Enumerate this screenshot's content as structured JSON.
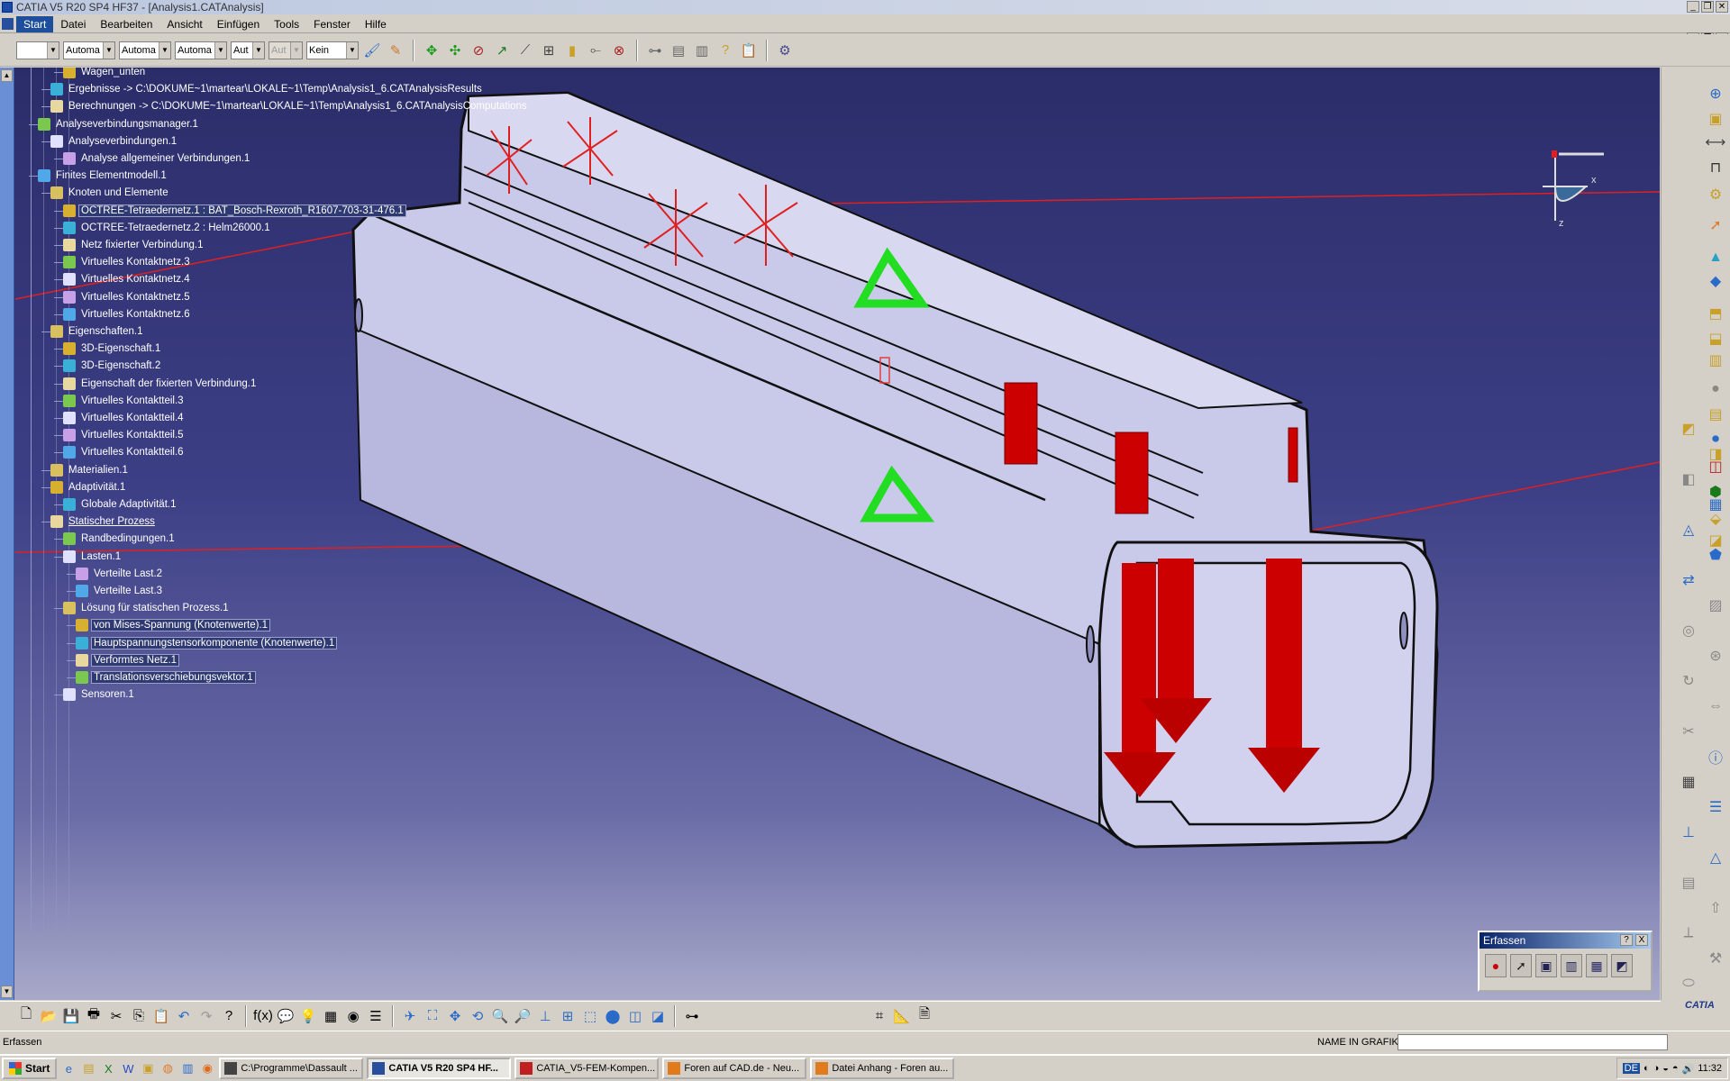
{
  "window": {
    "title": "CATIA V5 R20 SP4 HF37 - [Analysis1.CATAnalysis]"
  },
  "menu": [
    "Start",
    "Datei",
    "Bearbeiten",
    "Ansicht",
    "Einfügen",
    "Tools",
    "Fenster",
    "Hilfe"
  ],
  "toolbar": {
    "combo1": "",
    "combo2": "Automa",
    "combo3": "Automa",
    "combo4": "Automa",
    "combo5": "Aut",
    "combo6": "Aut",
    "combo7": "Kein"
  },
  "tree": [
    {
      "label": "Wagen_unten",
      "level": 3,
      "icon": "part-icon"
    },
    {
      "label": "Ergebnisse -> C:\\DOKUME~1\\martear\\LOKALE~1\\Temp\\Analysis1_6.CATAnalysisResults",
      "level": 2,
      "icon": "results-icon"
    },
    {
      "label": "Berechnungen -> C:\\DOKUME~1\\martear\\LOKALE~1\\Temp\\Analysis1_6.CATAnalysisComputations",
      "level": 2,
      "icon": "computations-icon"
    },
    {
      "label": "Analyseverbindungsmanager.1",
      "level": 1,
      "icon": "manager-icon"
    },
    {
      "label": "Analyseverbindungen.1",
      "level": 2,
      "icon": "connections-icon"
    },
    {
      "label": "Analyse allgemeiner Verbindungen.1",
      "level": 3,
      "icon": "connection-icon"
    },
    {
      "label": "Finites Elementmodell.1",
      "level": 1,
      "icon": "fem-icon"
    },
    {
      "label": "Knoten und Elemente",
      "level": 2,
      "icon": "nodes-icon"
    },
    {
      "label": "OCTREE-Tetraedernetz.1 : BAT_Bosch-Rexroth_R1607-703-31-476.1",
      "level": 3,
      "icon": "mesh-icon",
      "selected": true
    },
    {
      "label": "OCTREE-Tetraedernetz.2 : Helm26000.1",
      "level": 3,
      "icon": "mesh-icon"
    },
    {
      "label": "Netz fixierter Verbindung.1",
      "level": 3,
      "icon": "fixed-mesh-icon"
    },
    {
      "label": "Virtuelles Kontaktnetz.3",
      "level": 3,
      "icon": "contact-mesh-icon"
    },
    {
      "label": "Virtuelles Kontaktnetz.4",
      "level": 3,
      "icon": "contact-mesh-icon"
    },
    {
      "label": "Virtuelles Kontaktnetz.5",
      "level": 3,
      "icon": "contact-mesh-icon"
    },
    {
      "label": "Virtuelles Kontaktnetz.6",
      "level": 3,
      "icon": "contact-mesh-icon"
    },
    {
      "label": "Eigenschaften.1",
      "level": 2,
      "icon": "properties-icon"
    },
    {
      "label": "3D-Eigenschaft.1",
      "level": 3,
      "icon": "property3d-icon"
    },
    {
      "label": "3D-Eigenschaft.2",
      "level": 3,
      "icon": "property3d-icon"
    },
    {
      "label": "Eigenschaft der fixierten Verbindung.1",
      "level": 3,
      "icon": "fixed-property-icon"
    },
    {
      "label": "Virtuelles Kontaktteil.3",
      "level": 3,
      "icon": "contact-part-icon"
    },
    {
      "label": "Virtuelles Kontaktteil.4",
      "level": 3,
      "icon": "contact-part-icon"
    },
    {
      "label": "Virtuelles Kontaktteil.5",
      "level": 3,
      "icon": "contact-part-icon"
    },
    {
      "label": "Virtuelles Kontaktteil.6",
      "level": 3,
      "icon": "contact-part-icon"
    },
    {
      "label": "Materialien.1",
      "level": 2,
      "icon": "materials-icon"
    },
    {
      "label": "Adaptivität.1",
      "level": 2,
      "icon": "adaptivity-icon"
    },
    {
      "label": "Globale Adaptivität.1",
      "level": 3,
      "icon": "global-adaptivity-icon"
    },
    {
      "label": "Statischer Prozess",
      "level": 2,
      "icon": "static-case-icon",
      "underline": true
    },
    {
      "label": "Randbedingungen.1",
      "level": 3,
      "icon": "restraints-icon"
    },
    {
      "label": "Lasten.1",
      "level": 3,
      "icon": "loads-icon"
    },
    {
      "label": "Verteilte Last.2",
      "level": 4,
      "icon": "distributed-load-icon"
    },
    {
      "label": "Verteilte Last.3",
      "level": 4,
      "icon": "distributed-load-icon"
    },
    {
      "label": "Lösung für statischen Prozess.1",
      "level": 3,
      "icon": "solution-icon"
    },
    {
      "label": "von Mises-Spannung (Knotenwerte).1",
      "level": 4,
      "icon": "image-icon",
      "selected": true
    },
    {
      "label": "Hauptspannungstensorkomponente (Knotenwerte).1",
      "level": 4,
      "icon": "image-icon",
      "selected": true
    },
    {
      "label": "Verformtes Netz.1",
      "level": 4,
      "icon": "image-icon",
      "selected": true
    },
    {
      "label": "Translationsverschiebungsvektor.1",
      "level": 4,
      "icon": "image-icon",
      "selected": true
    },
    {
      "label": "Sensoren.1",
      "level": 3,
      "icon": "sensors-icon"
    }
  ],
  "compass": {
    "x_label": "x",
    "z_label": "z"
  },
  "erfassen": {
    "title": "Erfassen",
    "help": "?",
    "close": "X"
  },
  "status": {
    "message": "Erfassen",
    "name_label": "NAME IN GRAFIK:",
    "name_value": ""
  },
  "taskbar": {
    "start": "Start",
    "tasks": [
      {
        "label": "C:\\Programme\\Dassault ...",
        "active": false
      },
      {
        "label": "CATIA V5 R20 SP4 HF...",
        "active": true
      },
      {
        "label": "CATIA_V5-FEM-Kompen...",
        "active": false
      },
      {
        "label": "Foren auf CAD.de - Neu...",
        "active": false
      },
      {
        "label": "Datei Anhang - Foren au...",
        "active": false
      }
    ],
    "lang": "DE",
    "clock": "11:32"
  },
  "branding": {
    "logo": "CATIA"
  },
  "colors": {
    "accent": "#1e4f9c",
    "workspace_top": "#2b2d6a",
    "workspace_bottom": "#a8a9c9",
    "load_arrow": "#cc0000",
    "restraint": "#22dd22"
  }
}
